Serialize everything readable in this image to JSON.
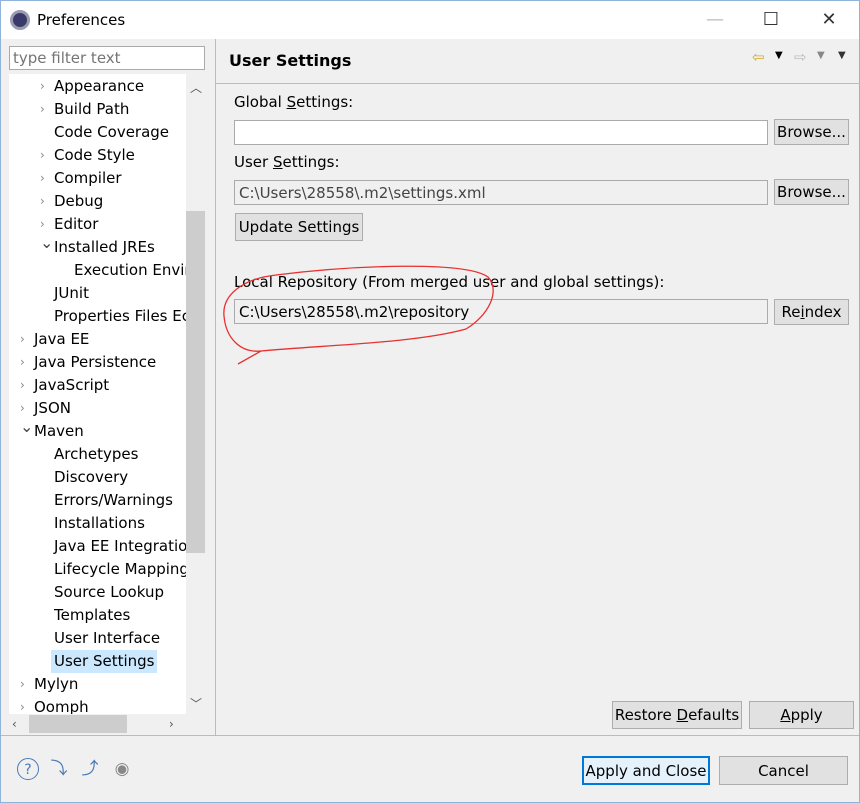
{
  "window": {
    "title": "Preferences",
    "minimize": "—",
    "maximize": "☐",
    "close": "✕"
  },
  "filter": {
    "placeholder": "type filter text"
  },
  "tree": [
    {
      "label": "Appearance",
      "level": 1,
      "state": "collapsed"
    },
    {
      "label": "Build Path",
      "level": 1,
      "state": "collapsed"
    },
    {
      "label": "Code Coverage",
      "level": 1,
      "state": "leaf"
    },
    {
      "label": "Code Style",
      "level": 1,
      "state": "collapsed"
    },
    {
      "label": "Compiler",
      "level": 1,
      "state": "collapsed"
    },
    {
      "label": "Debug",
      "level": 1,
      "state": "collapsed"
    },
    {
      "label": "Editor",
      "level": 1,
      "state": "collapsed"
    },
    {
      "label": "Installed JREs",
      "level": 1,
      "state": "expanded"
    },
    {
      "label": "Execution Envir",
      "level": 2,
      "state": "leaf"
    },
    {
      "label": "JUnit",
      "level": 1,
      "state": "leaf"
    },
    {
      "label": "Properties Files Ec",
      "level": 1,
      "state": "leaf"
    },
    {
      "label": "Java EE",
      "level": 0,
      "state": "collapsed"
    },
    {
      "label": "Java Persistence",
      "level": 0,
      "state": "collapsed"
    },
    {
      "label": "JavaScript",
      "level": 0,
      "state": "collapsed"
    },
    {
      "label": "JSON",
      "level": 0,
      "state": "collapsed"
    },
    {
      "label": "Maven",
      "level": 0,
      "state": "expanded"
    },
    {
      "label": "Archetypes",
      "level": 1,
      "state": "leaf"
    },
    {
      "label": "Discovery",
      "level": 1,
      "state": "leaf"
    },
    {
      "label": "Errors/Warnings",
      "level": 1,
      "state": "leaf"
    },
    {
      "label": "Installations",
      "level": 1,
      "state": "leaf"
    },
    {
      "label": "Java EE Integration",
      "level": 1,
      "state": "leaf"
    },
    {
      "label": "Lifecycle Mapping",
      "level": 1,
      "state": "leaf"
    },
    {
      "label": "Source Lookup",
      "level": 1,
      "state": "leaf"
    },
    {
      "label": "Templates",
      "level": 1,
      "state": "leaf"
    },
    {
      "label": "User Interface",
      "level": 1,
      "state": "leaf"
    },
    {
      "label": "User Settings",
      "level": 1,
      "state": "leaf",
      "selected": true
    },
    {
      "label": "Mylyn",
      "level": 0,
      "state": "collapsed"
    },
    {
      "label": "Oomph",
      "level": 0,
      "state": "collapsed"
    }
  ],
  "page": {
    "title": "User Settings",
    "global_label_pre": "Global ",
    "global_label_u": "S",
    "global_label_post": "ettings:",
    "global_value": "",
    "user_label_pre": "User ",
    "user_label_u": "S",
    "user_label_post": "ettings:",
    "user_value": "C:\\Users\\28558\\.m2\\settings.xml",
    "browse": "Browse...",
    "update": "Update Settings",
    "local_label": "Local Repository (From merged user and global settings):",
    "local_value": "C:\\Users\\28558\\.m2\\repository",
    "reindex_pre": "Re",
    "reindex_u": "i",
    "reindex_post": "ndex",
    "restore_pre": "Restore ",
    "restore_u": "D",
    "restore_post": "efaults",
    "apply_u": "A",
    "apply_post": "pply"
  },
  "footer": {
    "apply_close": "Apply and Close",
    "cancel": "Cancel"
  },
  "annotation_color": "#e83030"
}
